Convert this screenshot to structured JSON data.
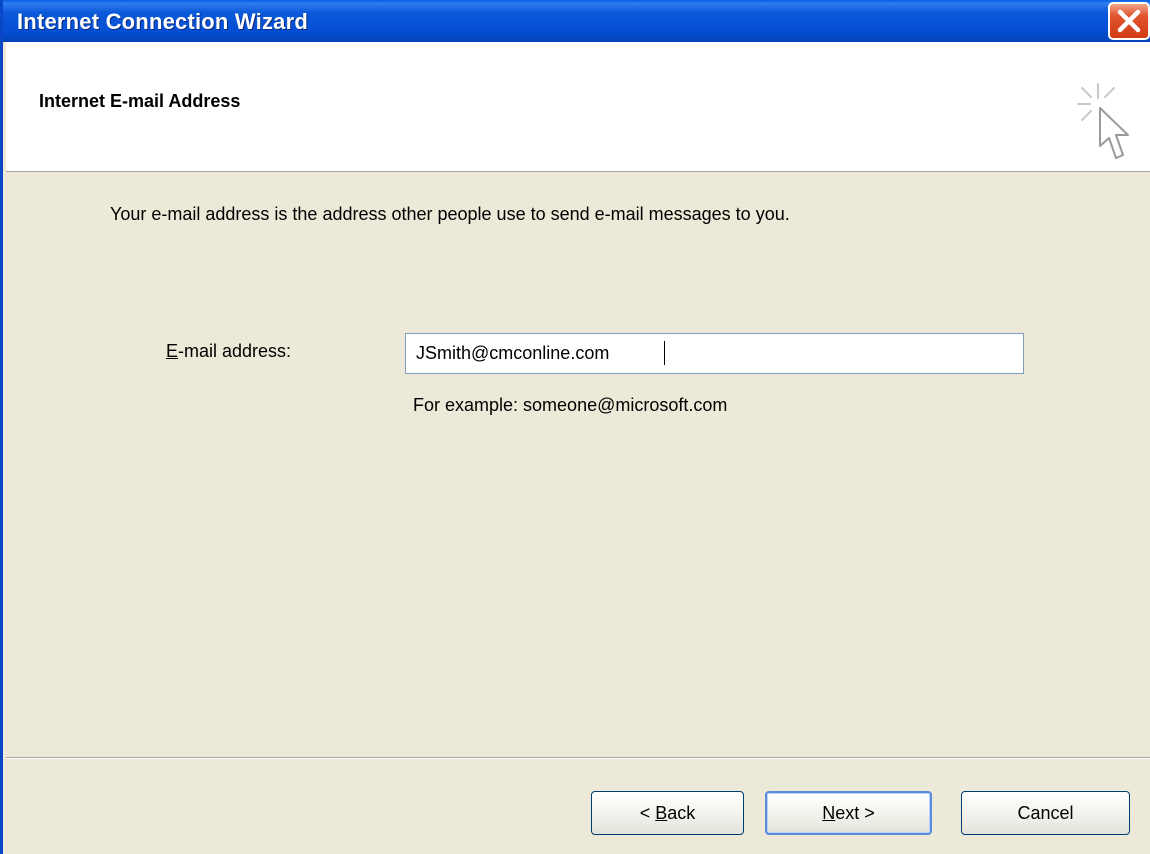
{
  "window": {
    "title": "Internet Connection Wizard"
  },
  "header": {
    "title": "Internet E-mail Address",
    "icon": "wizard-cursor-icon"
  },
  "content": {
    "description": "Your e-mail address is the address other people use to send e-mail messages to you.",
    "email_label_mnemonic": "E",
    "email_label_rest": "-mail address:",
    "email_value": "JSmith@cmconline.com",
    "example_text": "For example: someone@microsoft.com"
  },
  "buttons": {
    "back_prefix": "< ",
    "back_mnemonic": "B",
    "back_rest": "ack",
    "next_mnemonic": "N",
    "next_rest": "ext >",
    "cancel": "Cancel"
  },
  "colors": {
    "titlebar": "#0550D6",
    "dialog_background": "#ECE9D8",
    "close_button": "#D23C16"
  }
}
